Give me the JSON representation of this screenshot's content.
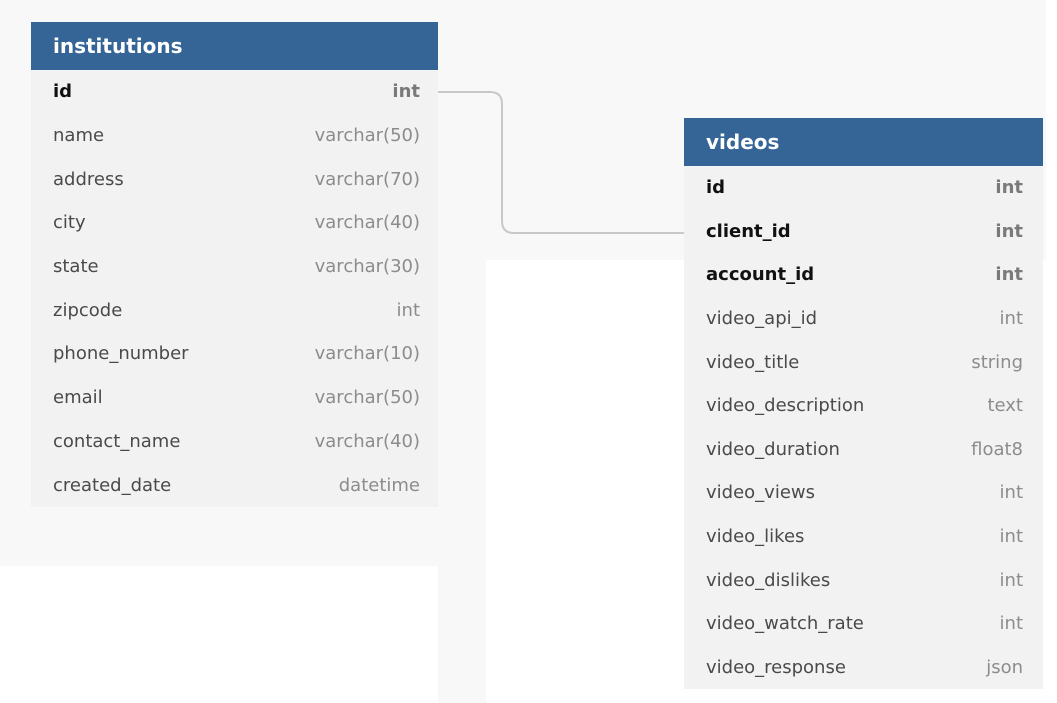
{
  "tables": {
    "institutions": {
      "title": "institutions",
      "columns": [
        {
          "name": "id",
          "type": "int",
          "key": true
        },
        {
          "name": "name",
          "type": "varchar(50)"
        },
        {
          "name": "address",
          "type": "varchar(70)"
        },
        {
          "name": "city",
          "type": "varchar(40)"
        },
        {
          "name": "state",
          "type": "varchar(30)"
        },
        {
          "name": "zipcode",
          "type": "int"
        },
        {
          "name": "phone_number",
          "type": "varchar(10)"
        },
        {
          "name": "email",
          "type": "varchar(50)"
        },
        {
          "name": "contact_name",
          "type": "varchar(40)"
        },
        {
          "name": "created_date",
          "type": "datetime"
        }
      ]
    },
    "videos": {
      "title": "videos",
      "columns": [
        {
          "name": "id",
          "type": "int",
          "key": true
        },
        {
          "name": "client_id",
          "type": "int",
          "key": true
        },
        {
          "name": "account_id",
          "type": "int",
          "key": true
        },
        {
          "name": "video_api_id",
          "type": "int"
        },
        {
          "name": "video_title",
          "type": "string"
        },
        {
          "name": "video_description",
          "type": "text"
        },
        {
          "name": "video_duration",
          "type": "float8"
        },
        {
          "name": "video_views",
          "type": "int"
        },
        {
          "name": "video_likes",
          "type": "int"
        },
        {
          "name": "video_dislikes",
          "type": "int"
        },
        {
          "name": "video_watch_rate",
          "type": "int"
        },
        {
          "name": "video_response",
          "type": "json"
        }
      ]
    }
  },
  "relationships": [
    {
      "from": "institutions.id",
      "to": "videos.client_id"
    }
  ],
  "colors": {
    "header": "#346596",
    "table_body": "#f2f2f2",
    "connector": "#c8c8c8"
  }
}
